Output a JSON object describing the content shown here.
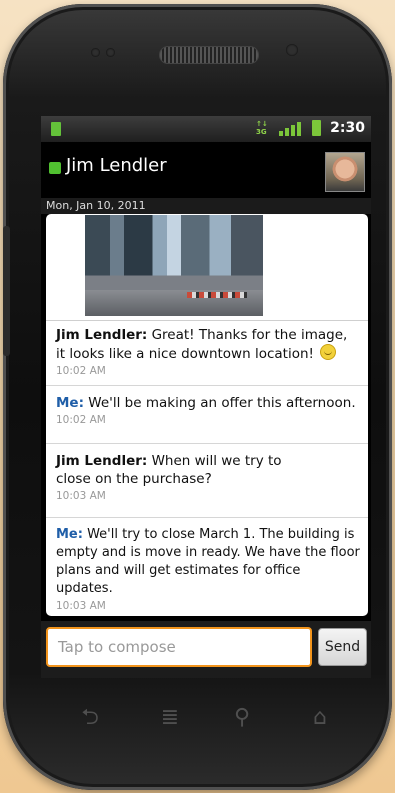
{
  "status_bar": {
    "network": "3G",
    "time": "2:30"
  },
  "header": {
    "contact_name": "Jim Lendler"
  },
  "conversation": {
    "date": "Mon, Jan 10, 2011",
    "messages": [
      {
        "sender": "Jim Lendler:",
        "text": " Great! Thanks for the image, it looks like a nice downtown location!",
        "time": "10:02 AM"
      },
      {
        "sender": "Me:",
        "text": " We'll be making an offer this afternoon.",
        "time": "10:02 AM"
      },
      {
        "sender": "Jim Lendler:",
        "text": " When will we try to close on the purchase?",
        "time": "10:03 AM"
      },
      {
        "sender": "Me:",
        "text": " We'll try to close March 1. The building is empty and is move in ready. We have the floor plans and will get estimates for office updates.",
        "time": "10:03 AM"
      }
    ]
  },
  "compose": {
    "placeholder": "Tap to compose",
    "send_label": "Send"
  },
  "nav_keys": {
    "back_glyph": "⮌",
    "menu_glyph": "≣",
    "search_glyph": "⚲",
    "home_glyph": "⌂"
  },
  "colors": {
    "accent": "#f2941c",
    "presence": "#50c030",
    "me_sender": "#1f5ea8"
  }
}
